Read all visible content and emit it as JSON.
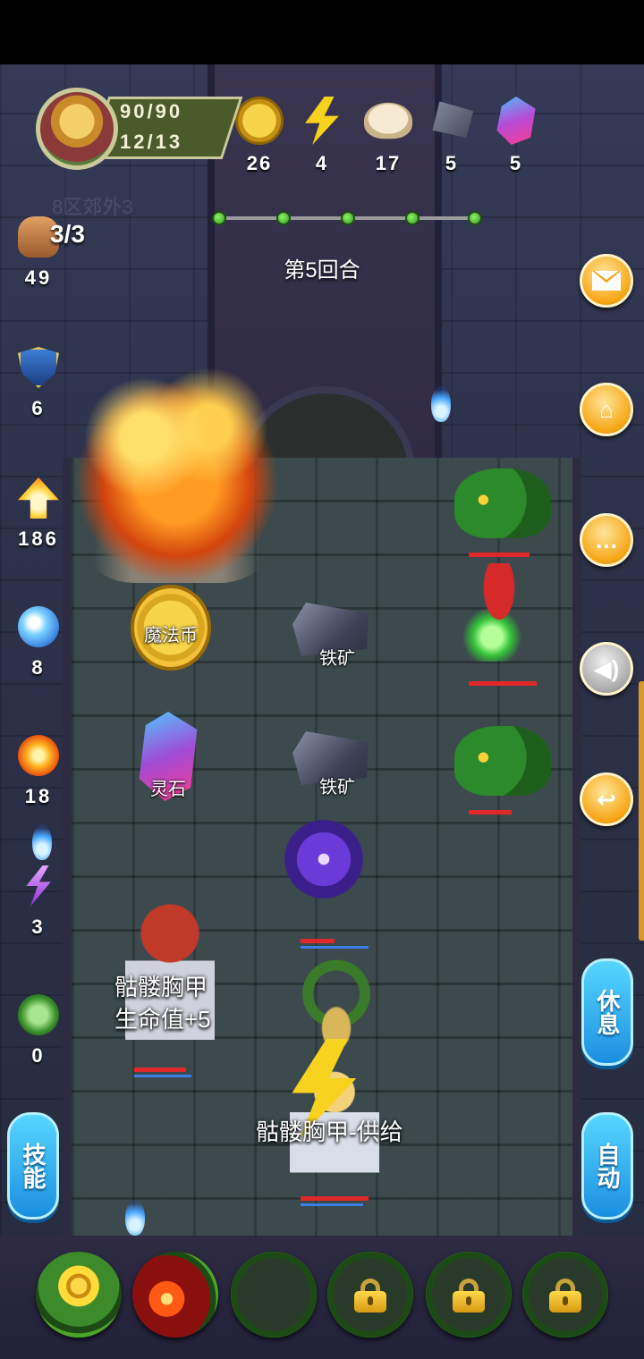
{
  "player": {
    "hp": "90/90",
    "energy": "12/13"
  },
  "resources": [
    {
      "icon": "gold-coin-icon",
      "value": "26"
    },
    {
      "icon": "lightning-bolt-icon",
      "value": "4"
    },
    {
      "icon": "steamed-bun-icon",
      "value": "17"
    },
    {
      "icon": "iron-ore-icon",
      "value": "5"
    },
    {
      "icon": "spirit-stone-icon",
      "value": "5"
    }
  ],
  "zone_label": "8区郊外3",
  "round_label": "第5回合",
  "round_progress": {
    "total": 5,
    "completed": 5
  },
  "left_stats": {
    "attack_count": "3/3",
    "attack": "49",
    "defense": "6",
    "power": "186",
    "water": "8",
    "fire": "18",
    "thunder": "3",
    "poison": "0"
  },
  "board_items": {
    "coin_label": "魔法币",
    "iron_label_1": "铁矿",
    "gem_label": "灵石",
    "iron_label_2": "铁矿"
  },
  "floating_text": {
    "buff_line_1": "骷髅胸甲",
    "buff_line_2": "生命值+5",
    "supply": "骷髅胸甲-供给"
  },
  "buttons": {
    "skills": "技能",
    "rest": "休息",
    "auto": "自动"
  },
  "right_menu": [
    "mail-icon",
    "home-icon",
    "chat-icon",
    "sound-icon",
    "return-icon"
  ],
  "skill_slots": [
    {
      "icon": "sunflower-icon",
      "locked": false
    },
    {
      "icon": "fire-slash-icon",
      "locked": false
    },
    {
      "icon": "empty-slot",
      "locked": false
    },
    {
      "icon": "lock-icon",
      "locked": true
    },
    {
      "icon": "lock-icon",
      "locked": true
    },
    {
      "icon": "lock-icon",
      "locked": true
    }
  ],
  "colors": {
    "accent_orange": "#f6a514",
    "accent_blue": "#1b8fe0",
    "hp_red": "#e02828",
    "mp_blue": "#3a7ee6"
  }
}
